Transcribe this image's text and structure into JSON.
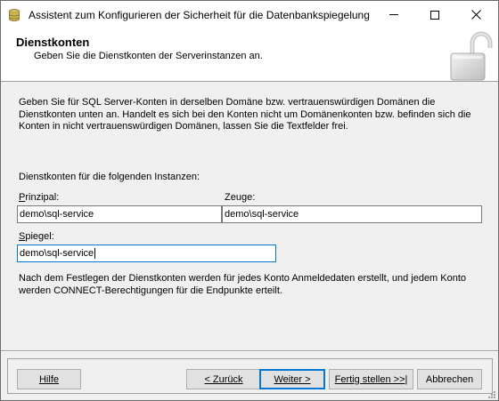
{
  "window": {
    "title": "Assistent zum Konfigurieren der Sicherheit für die Datenbankspiegelung"
  },
  "header": {
    "title": "Dienstkonten",
    "subtitle": "Geben Sie die Dienstkonten der Serverinstanzen an."
  },
  "content": {
    "intro": "Geben Sie für SQL Server-Konten in derselben Domäne bzw. vertrauenswürdigen Domänen die Dienstkonten unten an. Handelt es sich bei den Konten nicht um Domänenkonten bzw. befinden sich die Konten in nicht vertrauenswürdigen Domänen, lassen Sie die Textfelder frei.",
    "instances_label": "Dienstkonten für die folgenden Instanzen:",
    "principal_label": "Prinzipal:",
    "principal_value": "demo\\sql-service",
    "witness_label": "Zeuge:",
    "witness_value": "demo\\sql-service",
    "mirror_label": "Spiegel:",
    "mirror_value": "demo\\sql-service",
    "note": "Nach dem Festlegen der Dienstkonten werden für jedes Konto Anmeldedaten erstellt, und jedem Konto werden CONNECT-Berechtigungen für die Endpunkte erteilt."
  },
  "buttons": {
    "help": "Hilfe",
    "back": "< Zurück",
    "next": "Weiter >",
    "finish": "Fertig stellen >>|",
    "cancel": "Abbrechen"
  },
  "icons": {
    "app": "database-icon",
    "header": "padlock-icon"
  },
  "colors": {
    "focus_border": "#0078d7",
    "dialog_bg": "#f0f0f0",
    "button_bg": "#e1e1e1"
  }
}
